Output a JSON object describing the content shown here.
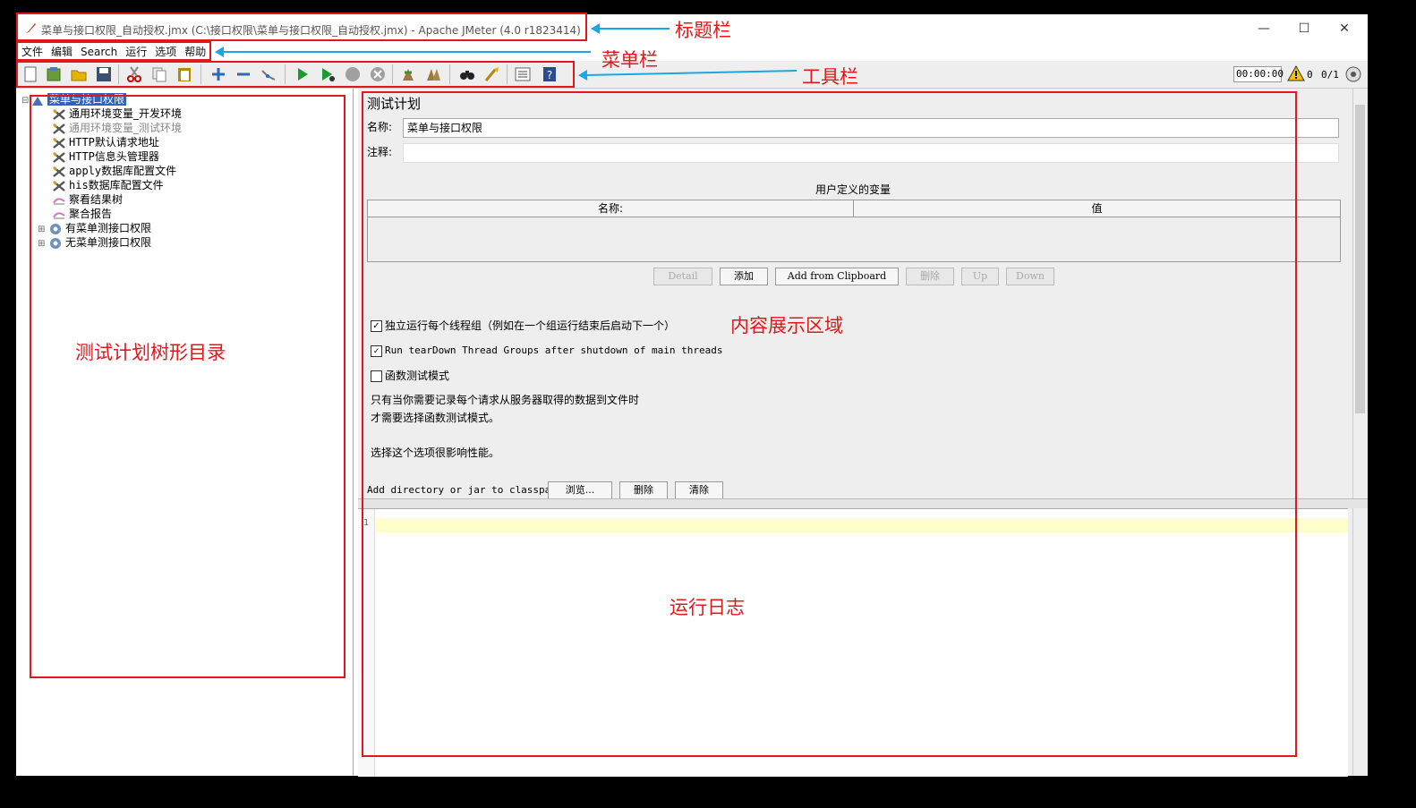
{
  "window": {
    "title": "菜单与接口权限_自动授权.jmx (C:\\接口权限\\菜单与接口权限_自动授权.jmx) - Apache JMeter (4.0 r1823414)",
    "controls": [
      "—",
      "☐",
      "✕"
    ]
  },
  "menu": [
    "文件",
    "编辑",
    "Search",
    "运行",
    "选项",
    "帮助"
  ],
  "toolbar": {
    "timer": "00:00:00",
    "warnings": "0",
    "threads": "0/1"
  },
  "tree": {
    "root": "菜单与接口权限",
    "items": [
      {
        "label": "通用环境变量_开发环境",
        "icon": "config-icon",
        "disabled": false
      },
      {
        "label": "通用环境变量_测试环境",
        "icon": "config-icon",
        "disabled": true
      },
      {
        "label": "HTTP默认请求地址",
        "icon": "config-icon",
        "disabled": false
      },
      {
        "label": "HTTP信息头管理器",
        "icon": "config-icon",
        "disabled": false
      },
      {
        "label": "apply数据库配置文件",
        "icon": "config-icon",
        "disabled": false
      },
      {
        "label": "his数据库配置文件",
        "icon": "config-icon",
        "disabled": false
      },
      {
        "label": "察看结果树",
        "icon": "listener-icon",
        "disabled": false
      },
      {
        "label": "聚合报告",
        "icon": "listener-icon",
        "disabled": false
      },
      {
        "label": "有菜单测接口权限",
        "icon": "thread-group-icon",
        "disabled": false
      },
      {
        "label": "无菜单测接口权限",
        "icon": "thread-group-icon",
        "disabled": false
      }
    ]
  },
  "panel": {
    "heading": "测试计划",
    "name_label": "名称:",
    "name_value": "菜单与接口权限",
    "comment_label": "注释:",
    "comment_value": "",
    "vars_title": "用户定义的变量",
    "col_name": "名称:",
    "col_value": "值",
    "buttons": {
      "detail": "Detail",
      "add": "添加",
      "add_clipboard": "Add from Clipboard",
      "delete": "删除",
      "up": "Up",
      "down": "Down"
    },
    "cb1": "独立运行每个线程组（例如在一个组运行结束后启动下一个）",
    "cb2": "Run tearDown Thread Groups after shutdown of main threads",
    "cb3": "函数测试模式",
    "note1": "只有当你需要记录每个请求从服务器取得的数据到文件时",
    "note2": "才需要选择函数测试模式。",
    "note3": "选择这个选项很影响性能。",
    "classpath_label": "Add directory or jar to classpath",
    "browse": "浏览...",
    "cp_delete": "删除",
    "cp_clear": "清除"
  },
  "log": {
    "line_no": "1"
  },
  "annotations": {
    "titlebar": "标题栏",
    "menubar": "菜单栏",
    "toolbar": "工具栏",
    "tree": "测试计划树形目录",
    "content": "内容展示区域",
    "log": "运行日志"
  }
}
